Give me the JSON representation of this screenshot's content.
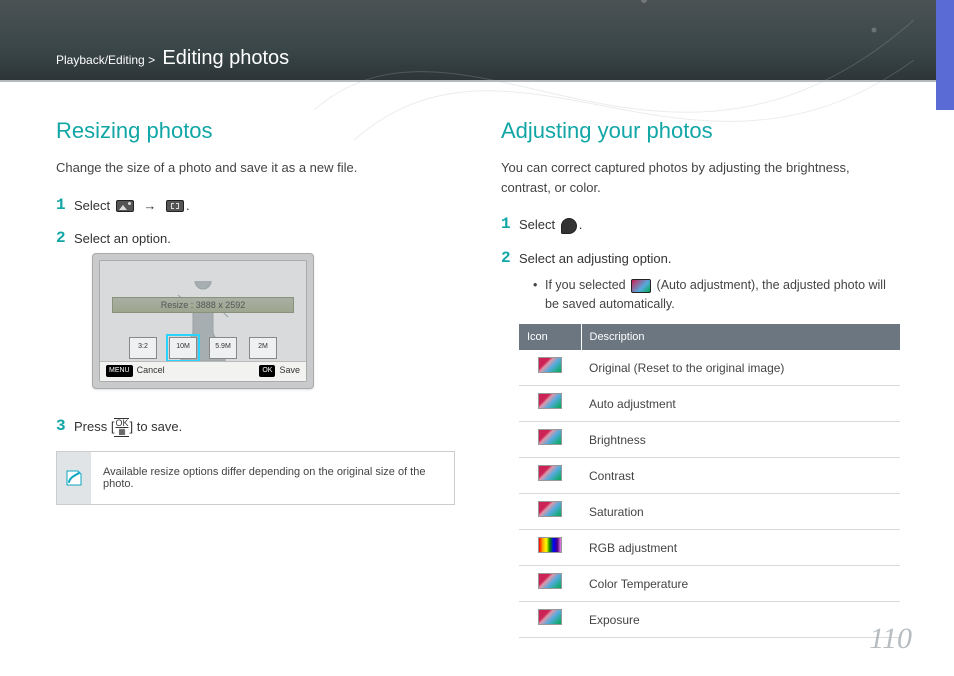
{
  "header": {
    "breadcrumb_section": "Playback/Editing",
    "breadcrumb_sep": ">",
    "title": "Editing photos"
  },
  "page_number": "110",
  "left": {
    "heading": "Resizing photos",
    "intro": "Change the size of a photo and save it as a new file.",
    "step1_prefix": "Select ",
    "step1_arrow": "→",
    "step1_suffix": ".",
    "step2": "Select an option.",
    "device": {
      "resize_label": "Resize : 3888 x 2592",
      "options": [
        "3:2",
        "10M",
        "5.9M",
        "2M"
      ],
      "menu_chip": "MENU",
      "menu_label": "Cancel",
      "ok_chip": "OK",
      "ok_label": "Save"
    },
    "step3_prefix": "Press [",
    "step3_key_top": "OK",
    "step3_suffix": "] to save.",
    "note": "Available resize options differ depending on the original size of the photo."
  },
  "right": {
    "heading": "Adjusting your photos",
    "intro": "You can correct captured photos by adjusting the brightness, contrast, or color.",
    "step1_prefix": "Select ",
    "step1_suffix": ".",
    "step2": "Select an adjusting option.",
    "bullet_prefix": "If you selected ",
    "bullet_mid": " (Auto adjustment), the adjusted photo will be saved automatically.",
    "table_headers": {
      "icon": "Icon",
      "desc": "Description"
    },
    "rows": [
      {
        "desc": "Original (Reset to the original image)"
      },
      {
        "desc": "Auto adjustment"
      },
      {
        "desc": "Brightness"
      },
      {
        "desc": "Contrast"
      },
      {
        "desc": "Saturation"
      },
      {
        "desc": "RGB adjustment",
        "rainbow": true
      },
      {
        "desc": "Color Temperature"
      },
      {
        "desc": "Exposure"
      }
    ]
  }
}
